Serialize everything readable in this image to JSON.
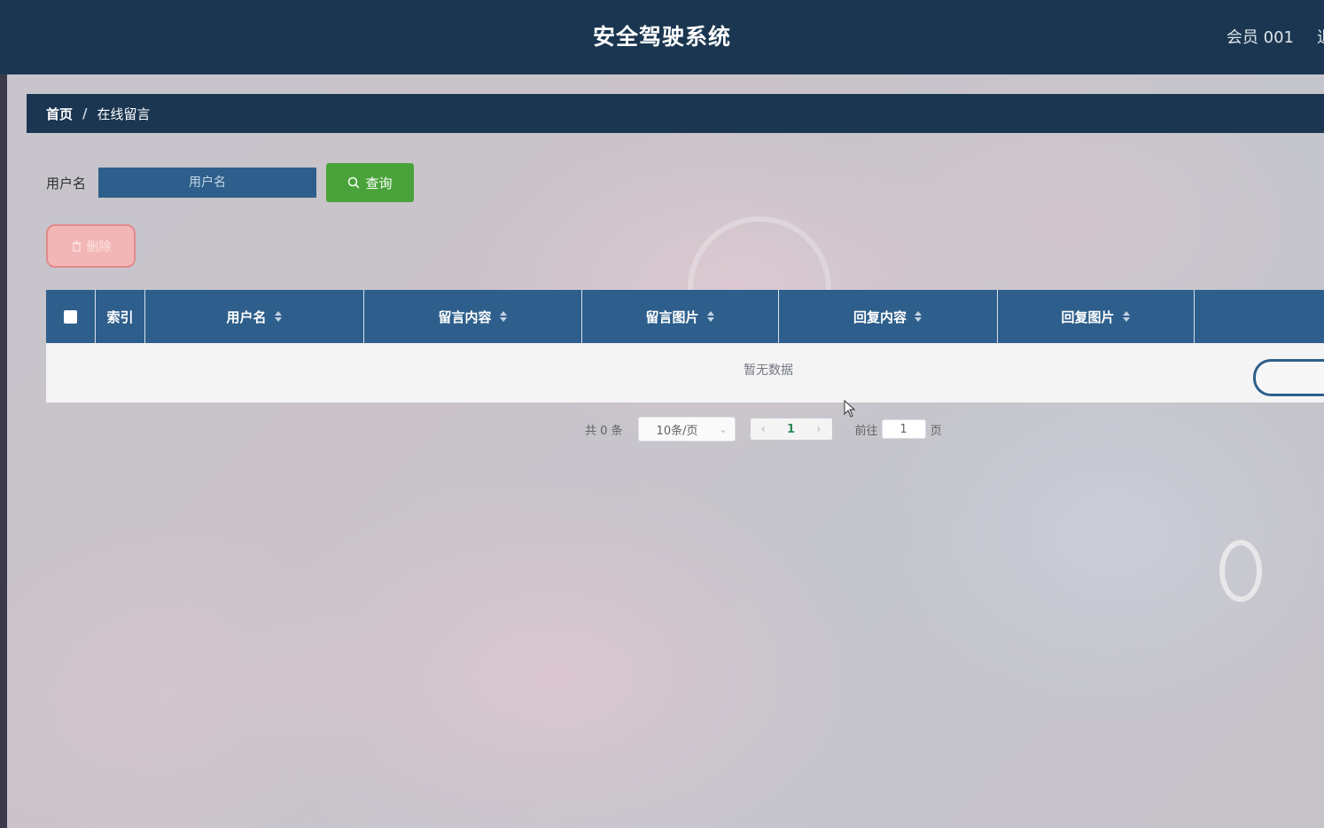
{
  "header": {
    "title": "安全驾驶系统",
    "user_label": "会员 001",
    "logout_stub": "退"
  },
  "breadcrumb": {
    "home": "首页",
    "separator": "/",
    "current": "在线留言"
  },
  "search": {
    "label": "用户名",
    "placeholder": "用户名",
    "query_label": "查询",
    "query_icon": "search-icon"
  },
  "toolbar": {
    "delete_label": "删除",
    "delete_icon": "trash-icon"
  },
  "table": {
    "columns": [
      {
        "label": "",
        "kind": "checkbox"
      },
      {
        "label": "索引",
        "sortable": false
      },
      {
        "label": "用户名",
        "sortable": true
      },
      {
        "label": "留言内容",
        "sortable": true
      },
      {
        "label": "留言图片",
        "sortable": true
      },
      {
        "label": "回复内容",
        "sortable": true
      },
      {
        "label": "回复图片",
        "sortable": true
      },
      {
        "label": "",
        "sortable": false
      }
    ],
    "empty_text": "暂无数据"
  },
  "pagination": {
    "total_text": "共 0 条",
    "page_size": "10条/页",
    "current_page": "1",
    "goto_label": "前往",
    "goto_value": "1",
    "page_suffix": "页"
  },
  "colors": {
    "header_bg": "#1a3650",
    "table_header_bg": "#2e5f8c",
    "query_button": "#4aa33a",
    "delete_button": "#f3b6b6"
  }
}
